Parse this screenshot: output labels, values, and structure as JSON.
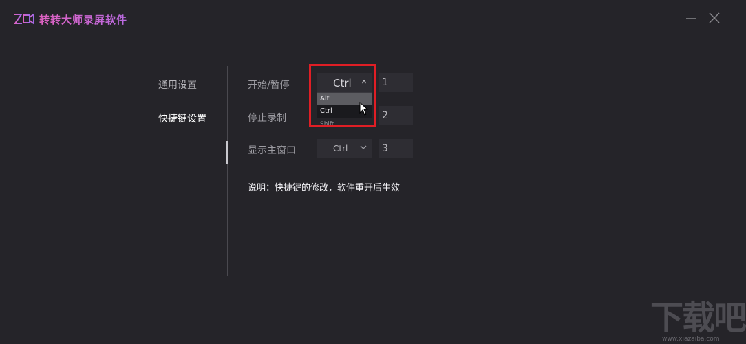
{
  "app": {
    "title": "转转大师录屏软件",
    "accent_colors": [
      "#e062c2",
      "#b96ae0"
    ],
    "logo_text": "Z"
  },
  "window_controls": {
    "minimize_icon": "minimize-icon",
    "close_icon": "close-icon"
  },
  "sidebar": {
    "items": [
      {
        "label": "通用设置",
        "active": false
      },
      {
        "label": "快捷键设置",
        "active": true
      }
    ]
  },
  "hotkeys": {
    "rows": [
      {
        "label": "开始/暂停",
        "modifier": "Ctrl",
        "key": "1"
      },
      {
        "label": "停止录制",
        "modifier": "Shift",
        "key": "2"
      },
      {
        "label": "显示主窗口",
        "modifier": "Ctrl",
        "key": "3"
      }
    ],
    "dropdown": {
      "selected": "Ctrl",
      "options": [
        "Alt",
        "Ctrl"
      ],
      "partially_visible_option": "Shift",
      "hovered": "Alt",
      "highlight_color": "#e01e25"
    },
    "note": "说明：快捷键的修改，软件重开后生效"
  },
  "watermark": {
    "main": "下载吧",
    "sub": "www.xiazaiba.com"
  }
}
